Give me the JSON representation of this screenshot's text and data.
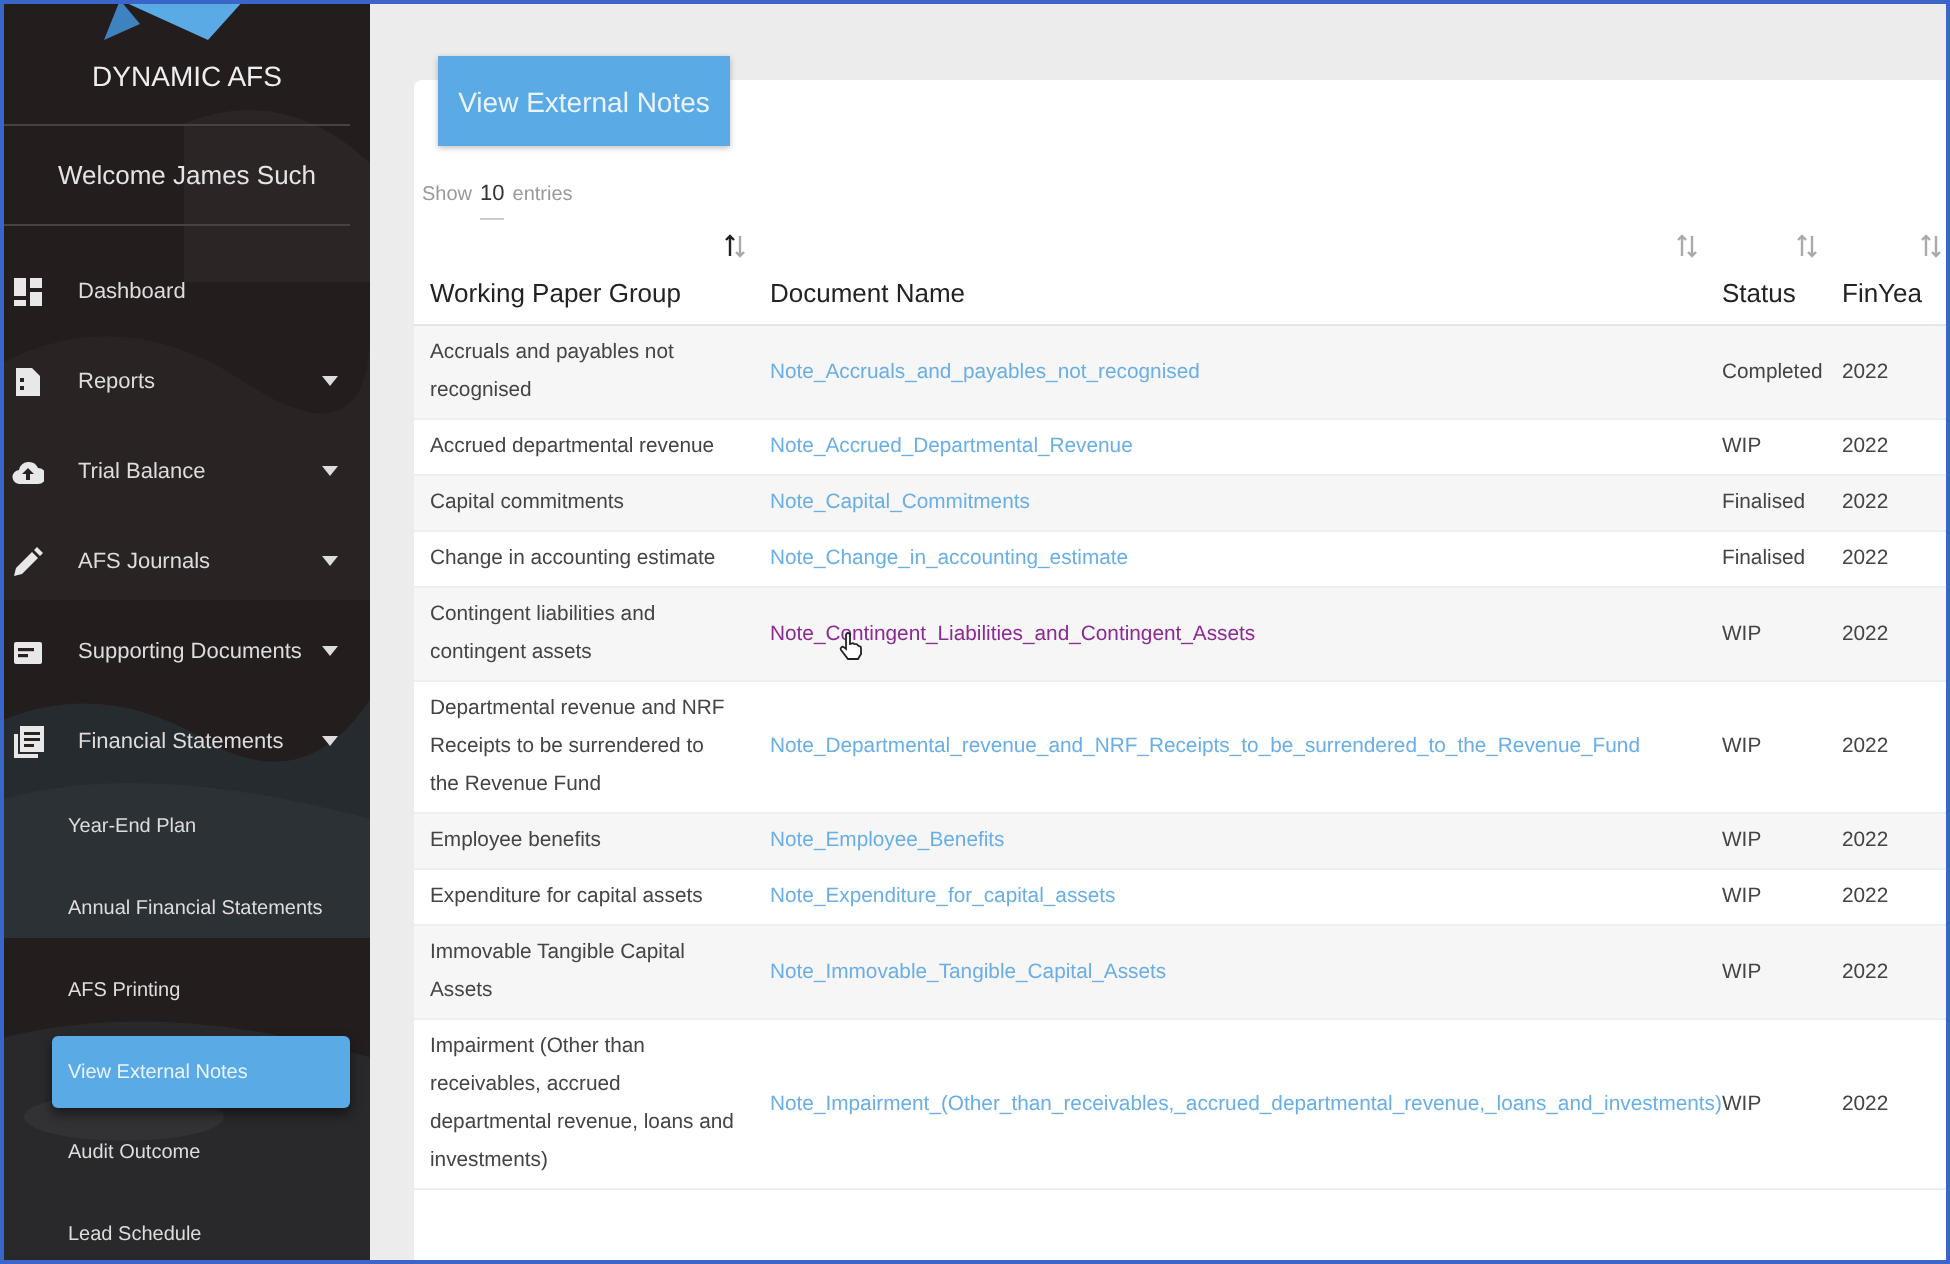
{
  "sidebar": {
    "brand": "DYNAMIC AFS",
    "welcome": "Welcome James Such",
    "items": [
      {
        "label": "Dashboard",
        "expandable": false
      },
      {
        "label": "Reports",
        "expandable": true
      },
      {
        "label": "Trial Balance",
        "expandable": true
      },
      {
        "label": "AFS Journals",
        "expandable": true
      },
      {
        "label": "Supporting Documents",
        "expandable": true
      },
      {
        "label": "Financial Statements",
        "expandable": true,
        "children": [
          {
            "label": "Year-End Plan",
            "selected": false
          },
          {
            "label": "Annual Financial Statements",
            "selected": false
          },
          {
            "label": "AFS Printing",
            "selected": false
          },
          {
            "label": "View External Notes",
            "selected": true
          },
          {
            "label": "Audit Outcome",
            "selected": false
          },
          {
            "label": "Lead Schedule",
            "selected": false
          }
        ]
      }
    ]
  },
  "main": {
    "button": "View External Notes",
    "length_menu": {
      "before": "Show",
      "value": "10",
      "after": "entries"
    },
    "table": {
      "columns": [
        {
          "label": "Working Paper Group",
          "sorted": true
        },
        {
          "label": "Document Name",
          "sorted": false
        },
        {
          "label": "Status",
          "sorted": false
        },
        {
          "label": "FinYea",
          "sorted": false
        }
      ],
      "rows": [
        {
          "group": "Accruals and payables not recognised",
          "document": "Note_Accruals_and_payables_not_recognised",
          "visited": false,
          "hovered": false,
          "status": "Completed",
          "year": "2022"
        },
        {
          "group": "Accrued departmental revenue",
          "document": "Note_Accrued_Departmental_Revenue",
          "visited": false,
          "hovered": false,
          "status": "WIP",
          "year": "2022"
        },
        {
          "group": "Capital commitments",
          "document": "Note_Capital_Commitments",
          "visited": false,
          "hovered": false,
          "status": "Finalised",
          "year": "2022"
        },
        {
          "group": "Change in accounting estimate",
          "document": "Note_Change_in_accounting_estimate",
          "visited": false,
          "hovered": false,
          "status": "Finalised",
          "year": "2022"
        },
        {
          "group": "Contingent liabilities and contingent assets",
          "document": "Note_Contingent_Liabilities_and_Contingent_Assets",
          "visited": true,
          "hovered": true,
          "status": "WIP",
          "year": "2022"
        },
        {
          "group": "Departmental revenue and NRF Receipts to be surrendered to the Revenue Fund",
          "document": "Note_Departmental_revenue_and_NRF_Receipts_to_be_surrendered_to_the_Revenue_Fund",
          "visited": false,
          "hovered": false,
          "status": "WIP",
          "year": "2022"
        },
        {
          "group": "Employee benefits",
          "document": "Note_Employee_Benefits",
          "visited": false,
          "hovered": false,
          "status": "WIP",
          "year": "2022"
        },
        {
          "group": "Expenditure for capital assets",
          "document": "Note_Expenditure_for_capital_assets",
          "visited": false,
          "hovered": false,
          "status": "WIP",
          "year": "2022"
        },
        {
          "group": "Immovable Tangible Capital Assets",
          "document": "Note_Immovable_Tangible_Capital_Assets",
          "visited": false,
          "hovered": false,
          "status": "WIP",
          "year": "2022"
        },
        {
          "group": "Impairment (Other than receivables, accrued departmental revenue, loans and investments)",
          "document": "Note_Impairment_(Other_than_receivables,_accrued_departmental_revenue,_loans_and_investments)",
          "visited": false,
          "hovered": false,
          "status": "WIP",
          "year": "2022"
        }
      ]
    }
  }
}
